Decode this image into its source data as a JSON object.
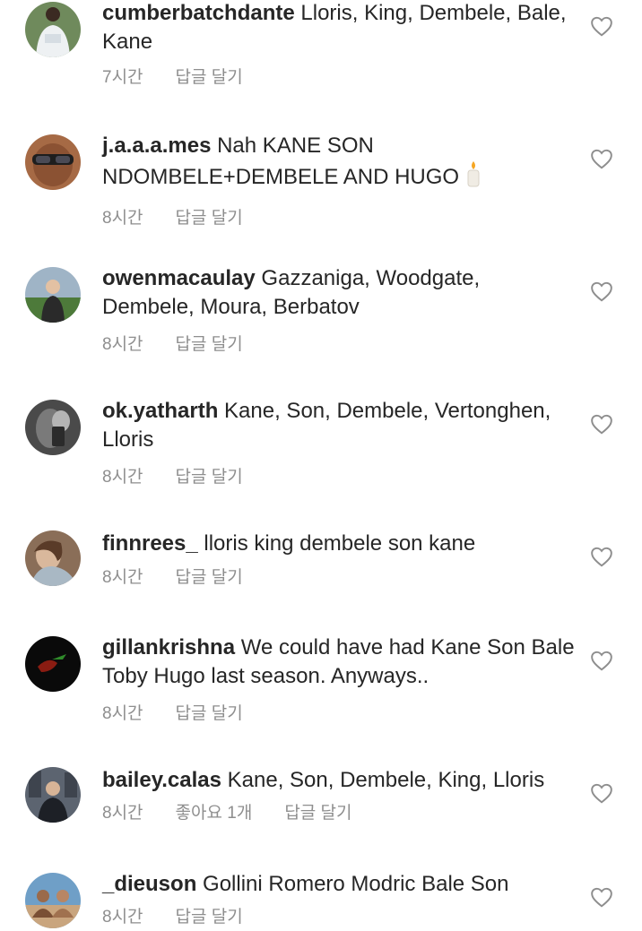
{
  "comments": [
    {
      "username": "cumberbatchdante",
      "text": "Lloris, King, Dembele, Bale, Kane",
      "time": "7시간",
      "likes": "",
      "reply": "답글 달기"
    },
    {
      "username": "j.a.a.a.mes",
      "text": "Nah KANE SON NDOMBELE+DEMBELE AND HUGO",
      "time": "8시간",
      "likes": "",
      "reply": "답글 달기"
    },
    {
      "username": "owenmacaulay",
      "text": "Gazzaniga, Woodgate, Dembele, Moura, Berbatov",
      "time": "8시간",
      "likes": "",
      "reply": "답글 달기"
    },
    {
      "username": "ok.yatharth",
      "text": "Kane, Son, Dembele, Vertonghen, Lloris",
      "time": "8시간",
      "likes": "",
      "reply": "답글 달기"
    },
    {
      "username": "finnrees_",
      "text": "lloris king dembele son kane",
      "time": "8시간",
      "likes": "",
      "reply": "답글 달기"
    },
    {
      "username": "gillankrishna",
      "text": "We could have had Kane Son Bale Toby Hugo last season. Anyways..",
      "time": "8시간",
      "likes": "",
      "reply": "답글 달기"
    },
    {
      "username": "bailey.calas",
      "text": "Kane, Son, Dembele, King, Lloris",
      "time": "8시간",
      "likes": "좋아요 1개",
      "reply": "답글 달기"
    },
    {
      "username": "_dieuson",
      "text": "Gollini Romero Modric Bale Son",
      "time": "8시간",
      "likes": "",
      "reply": "답글 달기"
    }
  ],
  "icons": {
    "like": "heart-outline-icon",
    "candle": "candle-emoji-icon"
  }
}
